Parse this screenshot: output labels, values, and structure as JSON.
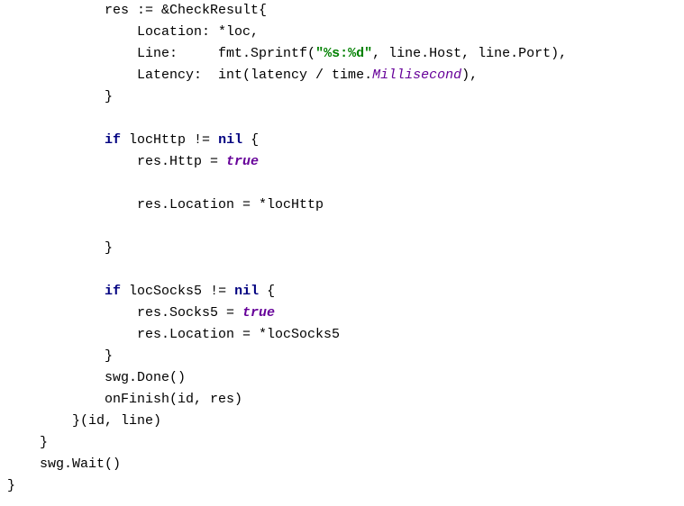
{
  "code": {
    "tokens": [
      {
        "indent": 12,
        "parts": [
          {
            "t": "res := &CheckResult{",
            "c": ""
          }
        ]
      },
      {
        "indent": 16,
        "parts": [
          {
            "t": "Location: *loc,",
            "c": ""
          }
        ]
      },
      {
        "indent": 16,
        "parts": [
          {
            "t": "Line:     fmt.Sprintf(",
            "c": ""
          },
          {
            "t": "\"%s:%d\"",
            "c": "str"
          },
          {
            "t": ", line.Host, line.Port),",
            "c": ""
          }
        ]
      },
      {
        "indent": 16,
        "parts": [
          {
            "t": "Latency:  int(latency / time.",
            "c": ""
          },
          {
            "t": "Millisecond",
            "c": "it"
          },
          {
            "t": "),",
            "c": ""
          }
        ]
      },
      {
        "indent": 12,
        "parts": [
          {
            "t": "}",
            "c": ""
          }
        ]
      },
      {
        "indent": 0,
        "parts": [
          {
            "t": "",
            "c": ""
          }
        ]
      },
      {
        "indent": 12,
        "parts": [
          {
            "t": "if",
            "c": "kw"
          },
          {
            "t": " locHttp != ",
            "c": ""
          },
          {
            "t": "nil",
            "c": "bk"
          },
          {
            "t": " {",
            "c": ""
          }
        ]
      },
      {
        "indent": 16,
        "parts": [
          {
            "t": "res.Http = ",
            "c": ""
          },
          {
            "t": "true",
            "c": "bk it"
          }
        ]
      },
      {
        "indent": 0,
        "parts": [
          {
            "t": "",
            "c": ""
          }
        ]
      },
      {
        "indent": 16,
        "parts": [
          {
            "t": "res.Location = *locHttp",
            "c": ""
          }
        ]
      },
      {
        "indent": 0,
        "parts": [
          {
            "t": "",
            "c": ""
          }
        ]
      },
      {
        "indent": 12,
        "parts": [
          {
            "t": "}",
            "c": ""
          }
        ]
      },
      {
        "indent": 0,
        "parts": [
          {
            "t": "",
            "c": ""
          }
        ]
      },
      {
        "indent": 12,
        "parts": [
          {
            "t": "if",
            "c": "kw"
          },
          {
            "t": " locSocks5 != ",
            "c": ""
          },
          {
            "t": "nil",
            "c": "bk"
          },
          {
            "t": " {",
            "c": ""
          }
        ]
      },
      {
        "indent": 16,
        "parts": [
          {
            "t": "res.Socks5 = ",
            "c": ""
          },
          {
            "t": "true",
            "c": "bk it"
          }
        ]
      },
      {
        "indent": 16,
        "parts": [
          {
            "t": "res.Location = *locSocks5",
            "c": ""
          }
        ]
      },
      {
        "indent": 12,
        "parts": [
          {
            "t": "}",
            "c": ""
          }
        ]
      },
      {
        "indent": 12,
        "parts": [
          {
            "t": "swg.Done()",
            "c": ""
          }
        ]
      },
      {
        "indent": 12,
        "parts": [
          {
            "t": "onFinish(id, res)",
            "c": ""
          }
        ]
      },
      {
        "indent": 8,
        "parts": [
          {
            "t": "}(id, line)",
            "c": ""
          }
        ]
      },
      {
        "indent": 4,
        "parts": [
          {
            "t": "}",
            "c": ""
          }
        ]
      },
      {
        "indent": 4,
        "parts": [
          {
            "t": "swg.Wait()",
            "c": ""
          }
        ]
      },
      {
        "indent": 0,
        "parts": [
          {
            "t": "}",
            "c": ""
          }
        ]
      }
    ]
  }
}
